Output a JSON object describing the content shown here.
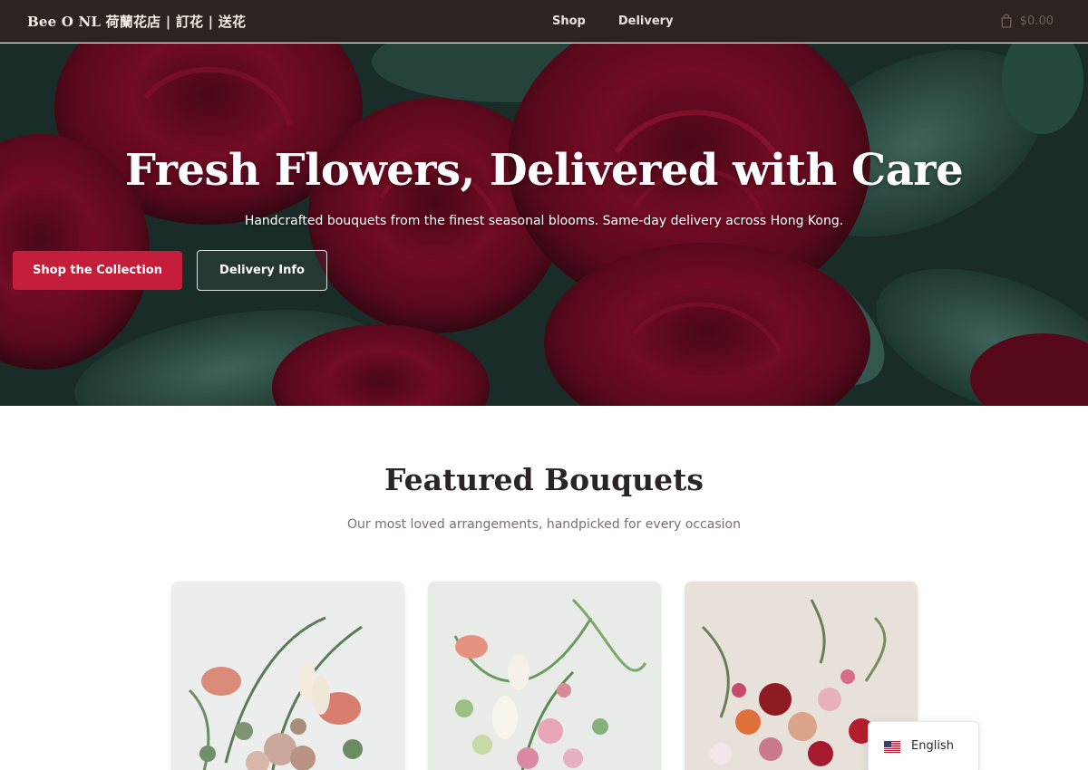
{
  "header": {
    "brand": "Bee O NL 荷蘭花店 | 訂花 | 送花",
    "nav": [
      "Shop",
      "Delivery"
    ],
    "cart_total": "$0.00"
  },
  "hero": {
    "title": "Fresh Flowers, Delivered with Care",
    "subtitle": "Handcrafted bouquets from the finest seasonal blooms. Same-day delivery across Hong Kong.",
    "primary_button": "Shop the Collection",
    "secondary_button": "Delivery Info"
  },
  "featured": {
    "title": "Featured Bouquets",
    "subtitle": "Our most loved arrangements, handpicked for every occasion"
  },
  "language": {
    "label": "English",
    "flag_icon": "us-flag-icon"
  },
  "colors": {
    "header_bg": "#2c2420",
    "accent": "#c41e3a"
  }
}
